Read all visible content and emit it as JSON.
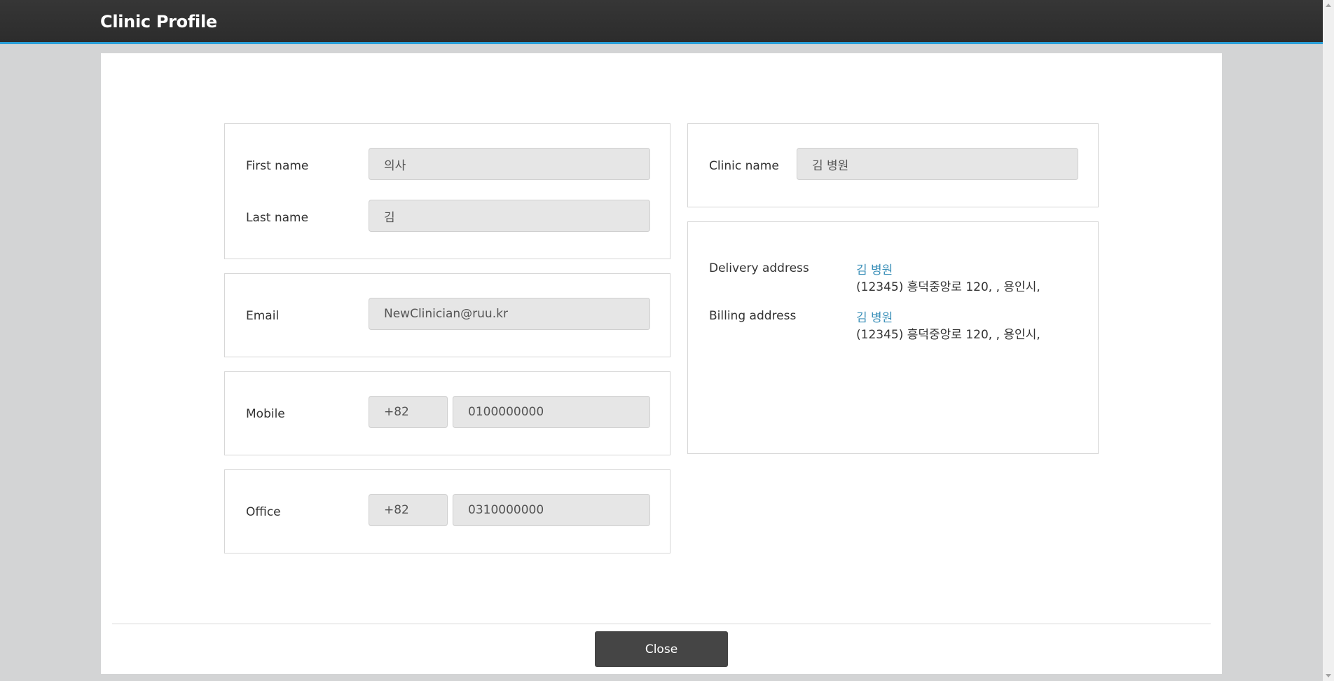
{
  "header": {
    "title": "Clinic Profile"
  },
  "profile": {
    "first_name_label": "First name",
    "first_name_value": "의사",
    "last_name_label": "Last name",
    "last_name_value": "김",
    "email_label": "Email",
    "email_value": "NewClinician@ruu.kr",
    "mobile_label": "Mobile",
    "mobile_code": "+82",
    "mobile_number": "0100000000",
    "office_label": "Office",
    "office_code": "+82",
    "office_number": "0310000000"
  },
  "clinic": {
    "name_label": "Clinic name",
    "name_value": "김 병원",
    "delivery_label": "Delivery address",
    "delivery_name": "김 병원",
    "delivery_address": "(12345) 흥덕중앙로 120, , 용인시,",
    "billing_label": "Billing address",
    "billing_name": "김 병원",
    "billing_address": "(12345) 흥덕중앙로 120, , 용인시,"
  },
  "footer": {
    "close_label": "Close"
  },
  "colors": {
    "accent": "#2a9fd8",
    "link": "#3a8fb8",
    "header_bg": "#2f2f2f",
    "button_bg": "#454545"
  }
}
